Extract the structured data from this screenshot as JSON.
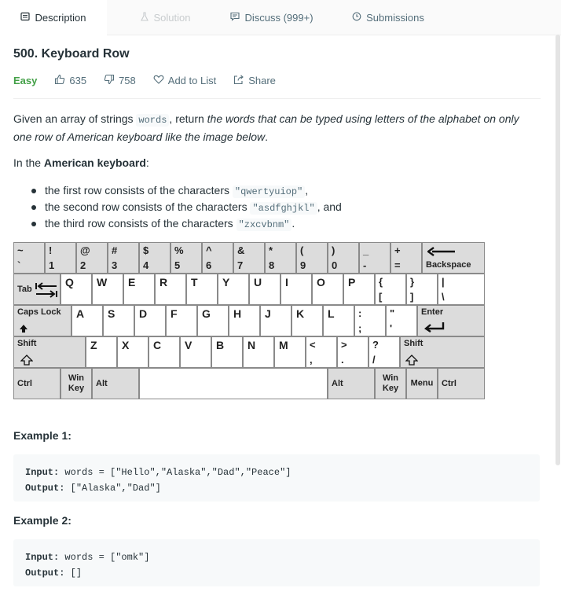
{
  "tabs": [
    {
      "label": "Description",
      "icon": "description-icon"
    },
    {
      "label": "Solution",
      "icon": "flask-icon"
    },
    {
      "label": "Discuss (999+)",
      "icon": "discuss-icon"
    },
    {
      "label": "Submissions",
      "icon": "clock-icon"
    }
  ],
  "problem": {
    "title": "500. Keyboard Row",
    "difficulty": "Easy",
    "likes": "635",
    "dislikes": "758",
    "add_to_list": "Add to List",
    "share": "Share"
  },
  "description": {
    "p1_a": "Given an array of strings ",
    "p1_code": "words",
    "p1_b": ", return ",
    "p1_em": "the words that can be typed using letters of the alphabet on only one row of American keyboard like the image below",
    "p1_c": ".",
    "p2_a": "In the ",
    "p2_bold": "American keyboard",
    "p2_b": ":",
    "rows": [
      {
        "text": "the first row consists of the characters ",
        "code": "\"qwertyuiop\"",
        "tail": ","
      },
      {
        "text": "the second row consists of the characters ",
        "code": "\"asdfghjkl\"",
        "tail": ", and"
      },
      {
        "text": "the third row consists of the characters ",
        "code": "\"zxcvbnm\"",
        "tail": "."
      }
    ]
  },
  "keyboard": {
    "row1": [
      {
        "top": "~",
        "bottom": "`"
      },
      {
        "top": "!",
        "bottom": "1"
      },
      {
        "top": "@",
        "bottom": "2"
      },
      {
        "top": "#",
        "bottom": "3"
      },
      {
        "top": "$",
        "bottom": "4"
      },
      {
        "top": "%",
        "bottom": "5"
      },
      {
        "top": "^",
        "bottom": "6"
      },
      {
        "top": "&",
        "bottom": "7"
      },
      {
        "top": "*",
        "bottom": "8"
      },
      {
        "top": "(",
        "bottom": "9"
      },
      {
        "top": ")",
        "bottom": "0"
      },
      {
        "top": "_",
        "bottom": "-"
      },
      {
        "top": "+",
        "bottom": "="
      }
    ],
    "backspace": "Backspace",
    "tab": "Tab",
    "row2": [
      "Q",
      "W",
      "E",
      "R",
      "T",
      "Y",
      "U",
      "I",
      "O",
      "P"
    ],
    "row2_brackets": [
      {
        "top": "{",
        "bottom": "["
      },
      {
        "top": "}",
        "bottom": "]"
      },
      {
        "top": "|",
        "bottom": "\\"
      }
    ],
    "caps": "Caps Lock",
    "row3": [
      "A",
      "S",
      "D",
      "F",
      "G",
      "H",
      "J",
      "K",
      "L"
    ],
    "row3_punct": [
      {
        "top": ":",
        "bottom": ";"
      },
      {
        "top": "\"",
        "bottom": "'"
      }
    ],
    "enter": "Enter",
    "shift": "Shift",
    "row4": [
      "Z",
      "X",
      "C",
      "V",
      "B",
      "N",
      "M"
    ],
    "row4_punct": [
      {
        "top": "<",
        "bottom": ","
      },
      {
        "top": ">",
        "bottom": "."
      },
      {
        "top": "?",
        "bottom": "/"
      }
    ],
    "ctrl": "Ctrl",
    "win": "Win Key",
    "alt": "Alt",
    "menu": "Menu"
  },
  "examples": [
    {
      "title": "Example 1:",
      "input_label": "Input:",
      "input": "words = [\"Hello\",\"Alaska\",\"Dad\",\"Peace\"]",
      "output_label": "Output:",
      "output": "[\"Alaska\",\"Dad\"]"
    },
    {
      "title": "Example 2:",
      "input_label": "Input:",
      "input": "words = [\"omk\"]",
      "output_label": "Output:",
      "output": "[]"
    }
  ]
}
